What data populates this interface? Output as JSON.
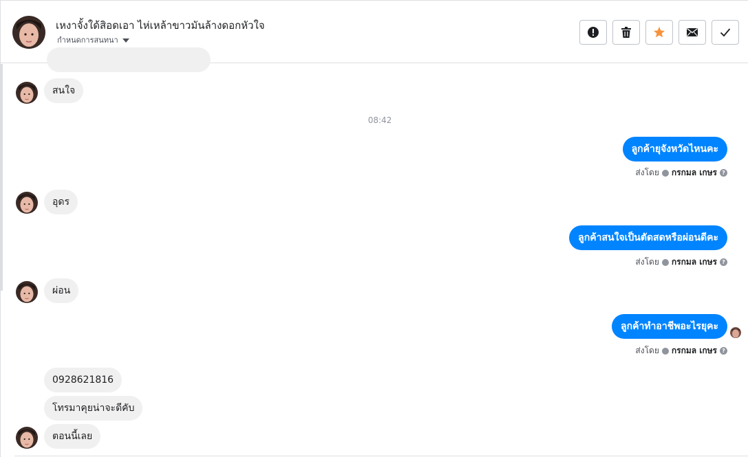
{
  "header": {
    "name": "เหงาจั้งใด้สิอดเอา ไห่เหล้าขาวมันล้างดอกหัวใจ",
    "subtitle": "กำหนดการสนทนา"
  },
  "actions": [
    {
      "name": "report-button",
      "icon": "exclamation-icon"
    },
    {
      "name": "delete-button",
      "icon": "trash-icon"
    },
    {
      "name": "star-button",
      "icon": "star-icon"
    },
    {
      "name": "mark-unread-button",
      "icon": "envelope-icon"
    },
    {
      "name": "mark-done-button",
      "icon": "check-icon"
    }
  ],
  "colors": {
    "outgoing": "#0084ff",
    "incoming": "#f1f0f0",
    "star": "#f7923a"
  },
  "messages": {
    "m1": "สนใจ",
    "time1": "08:42",
    "o1": "ลูกค้ายุจังหวัดไหนคะ",
    "m2": "อุดร",
    "o2": "ลูกค้าสนใจเป็นตัดสดหรือผ่อนดีคะ",
    "m3": "ผ่อน",
    "o3": "ลูกค้าทำอาชีพอะไรยุคะ",
    "m4": "0928621816",
    "m5": "โทรมาคุยน่าจะดีคับ",
    "m6": "ตอนนี้เลย"
  },
  "sent_by": {
    "prefix": "ส่งโดย",
    "who": "กรกมล เกษร"
  }
}
